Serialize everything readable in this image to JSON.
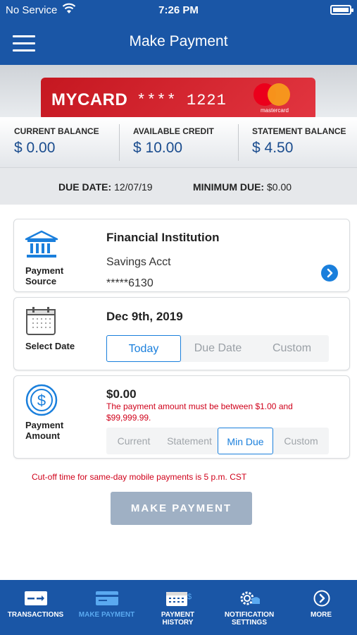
{
  "status_bar": {
    "carrier": "No Service",
    "time": "7:26 PM"
  },
  "header": {
    "title": "Make Payment"
  },
  "card": {
    "name": "MYCARD",
    "number": "**** 1221",
    "network": "mastercard"
  },
  "balances": [
    {
      "label": "CURRENT BALANCE",
      "value": "$ 0.00"
    },
    {
      "label": "AVAILABLE CREDIT",
      "value": "$ 10.00"
    },
    {
      "label": "STATEMENT BALANCE",
      "value": "$ 4.50"
    }
  ],
  "due": {
    "due_date_label": "DUE DATE:",
    "due_date_value": "12/07/19",
    "min_due_label": "MINIMUM DUE:",
    "min_due_value": "$0.00"
  },
  "payment_source": {
    "icon_label_1": "Payment",
    "icon_label_2": "Source",
    "institution": "Financial Institution",
    "account_type": "Savings Acct",
    "account_number": "*****6130"
  },
  "select_date": {
    "icon_label": "Select Date",
    "date": "Dec 9th, 2019",
    "options": [
      "Today",
      "Due Date",
      "Custom"
    ],
    "selected": "Today"
  },
  "payment_amount": {
    "icon_label_1": "Payment",
    "icon_label_2": "Amount",
    "amount": "$0.00",
    "error_line_1": "The payment amount must be between $1.00 and",
    "error_line_2": "$99,999.99.",
    "options": [
      "Current",
      "Statement",
      "Min Due",
      "Custom"
    ],
    "selected": "Min Due"
  },
  "cutoff_note": "Cut-off time for same-day mobile payments is 5 p.m. CST",
  "make_payment_button": "MAKE PAYMENT",
  "tabbar": [
    {
      "label_1": "TRANSACTIONS",
      "label_2": "",
      "icon": "transactions-icon",
      "active": false
    },
    {
      "label_1": "MAKE PAYMENT",
      "label_2": "",
      "icon": "card-payment-icon",
      "active": true
    },
    {
      "label_1": "PAYMENT",
      "label_2": "HISTORY",
      "icon": "calendar-history-icon",
      "active": false
    },
    {
      "label_1": "NOTIFICATION",
      "label_2": "SETTINGS",
      "icon": "gear-notification-icon",
      "active": false
    },
    {
      "label_1": "MORE",
      "label_2": "",
      "icon": "chevron-right-circle-icon",
      "active": false
    }
  ],
  "colors": {
    "brand_blue": "#1a56a6",
    "accent_blue": "#1a7fdc",
    "card_red": "#c51720",
    "error_red": "#d0021b",
    "button_disabled": "#9fb0c4"
  }
}
